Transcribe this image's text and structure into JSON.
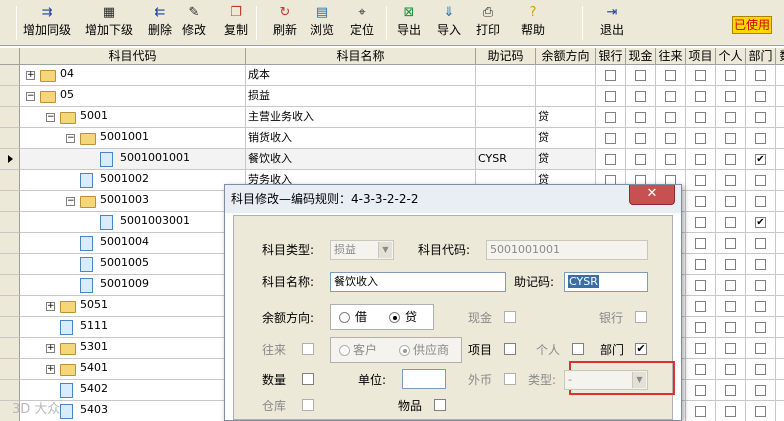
{
  "toolbar": {
    "buttons": [
      {
        "label": "增加同级",
        "icon": "add-sibling-icon",
        "glyph": "⇉"
      },
      {
        "label": "增加下级",
        "icon": "add-child-icon",
        "glyph": "▦"
      },
      {
        "label": "删除",
        "icon": "delete-icon",
        "glyph": "⇇"
      },
      {
        "label": "修改",
        "icon": "edit-icon",
        "glyph": "✎"
      },
      {
        "label": "复制",
        "icon": "copy-icon",
        "glyph": "❐"
      },
      {
        "label": "刷新",
        "icon": "refresh-icon",
        "glyph": "↻"
      },
      {
        "label": "浏览",
        "icon": "browse-icon",
        "glyph": "▤"
      },
      {
        "label": "定位",
        "icon": "locate-icon",
        "glyph": "⌖"
      },
      {
        "label": "导出",
        "icon": "export-icon",
        "glyph": "⊠"
      },
      {
        "label": "导入",
        "icon": "import-icon",
        "glyph": "⇓"
      },
      {
        "label": "打印",
        "icon": "print-icon",
        "glyph": "⎙"
      },
      {
        "label": "帮助",
        "icon": "help-icon",
        "glyph": "?"
      },
      {
        "label": "退出",
        "icon": "exit-icon",
        "glyph": "⇥"
      }
    ],
    "status_badge": "已使用",
    "accent_color": "#ffd800"
  },
  "grid": {
    "columns": [
      "科目代码",
      "科目名称",
      "助记码",
      "余额方向",
      "银行",
      "现金",
      "往来",
      "项目",
      "个人",
      "部门",
      "数"
    ],
    "rows": [
      {
        "code": "04",
        "name": "成本",
        "mnemonic": "",
        "direction": "",
        "checks": [
          false,
          false,
          false,
          false,
          false,
          false
        ]
      },
      {
        "code": "05",
        "name": "损益",
        "mnemonic": "",
        "direction": "",
        "checks": [
          false,
          false,
          false,
          false,
          false,
          false
        ]
      },
      {
        "code": "5001",
        "name": "主营业务收入",
        "mnemonic": "",
        "direction": "贷",
        "checks": [
          false,
          false,
          false,
          false,
          false,
          false
        ]
      },
      {
        "code": "5001001",
        "name": "销货收入",
        "mnemonic": "",
        "direction": "贷",
        "checks": [
          false,
          false,
          false,
          false,
          false,
          false
        ]
      },
      {
        "code": "5001001001",
        "name": "餐饮收入",
        "mnemonic": "CYSR",
        "direction": "贷",
        "checks": [
          false,
          false,
          false,
          false,
          false,
          true
        ]
      },
      {
        "code": "5001002",
        "name": "劳务收入",
        "mnemonic": "",
        "direction": "贷",
        "checks": [
          false,
          false,
          false,
          false,
          false,
          false
        ]
      },
      {
        "code": "5001003",
        "name": "",
        "mnemonic": "",
        "direction": "",
        "checks": [
          false,
          false,
          false,
          false,
          false,
          false
        ]
      },
      {
        "code": "5001003001",
        "name": "",
        "mnemonic": "",
        "direction": "",
        "checks": [
          false,
          false,
          false,
          false,
          false,
          true
        ]
      },
      {
        "code": "5001004",
        "name": "",
        "mnemonic": "",
        "direction": "",
        "checks": [
          false,
          false,
          false,
          false,
          false,
          false
        ]
      },
      {
        "code": "5001005",
        "name": "",
        "mnemonic": "",
        "direction": "",
        "checks": [
          false,
          false,
          false,
          false,
          false,
          false
        ]
      },
      {
        "code": "5001009",
        "name": "",
        "mnemonic": "",
        "direction": "",
        "checks": [
          false,
          false,
          false,
          false,
          false,
          false
        ]
      },
      {
        "code": "5051",
        "name": "",
        "mnemonic": "",
        "direction": "",
        "checks": [
          false,
          false,
          false,
          false,
          false,
          false
        ]
      },
      {
        "code": "5111",
        "name": "",
        "mnemonic": "",
        "direction": "",
        "checks": [
          false,
          false,
          false,
          false,
          false,
          false
        ]
      },
      {
        "code": "5301",
        "name": "",
        "mnemonic": "",
        "direction": "",
        "checks": [
          false,
          false,
          false,
          false,
          false,
          false
        ]
      },
      {
        "code": "5401",
        "name": "",
        "mnemonic": "",
        "direction": "",
        "checks": [
          false,
          false,
          false,
          false,
          false,
          false
        ]
      },
      {
        "code": "5402",
        "name": "",
        "mnemonic": "",
        "direction": "",
        "checks": [
          false,
          false,
          false,
          false,
          false,
          false
        ]
      },
      {
        "code": "5403",
        "name": "",
        "mnemonic": "",
        "direction": "",
        "checks": [
          false,
          false,
          false,
          false,
          false,
          false
        ]
      }
    ]
  },
  "dialog": {
    "title": "科目修改—编码规则：4-3-3-2-2-2",
    "close_glyph": "✕",
    "type_label": "科目类型:",
    "type_value": "损益",
    "code_label": "科目代码:",
    "code_value": "5001001001",
    "name_label": "科目名称:",
    "name_value": "餐饮收入",
    "mnemonic_label": "助记码:",
    "mnemonic_value": "CYSR",
    "direction_label": "余额方向:",
    "debit_label": "借",
    "credit_label": "贷",
    "cash_label": "现金",
    "bank_label": "银行",
    "current_label": "往来",
    "customer_label": "客户",
    "supplier_label": "供应商",
    "project_label": "项目",
    "personal_label": "个人",
    "department_label": "部门",
    "quantity_label": "数量",
    "unit_label": "单位:",
    "foreign_label": "外币",
    "currency_type_label": "类型:",
    "currency_type_value": "-",
    "warehouse_label": "仓库",
    "goods_label": "物品",
    "department_checked": true,
    "highlight_color": "#d9342b"
  },
  "watermark": "3D 大众"
}
